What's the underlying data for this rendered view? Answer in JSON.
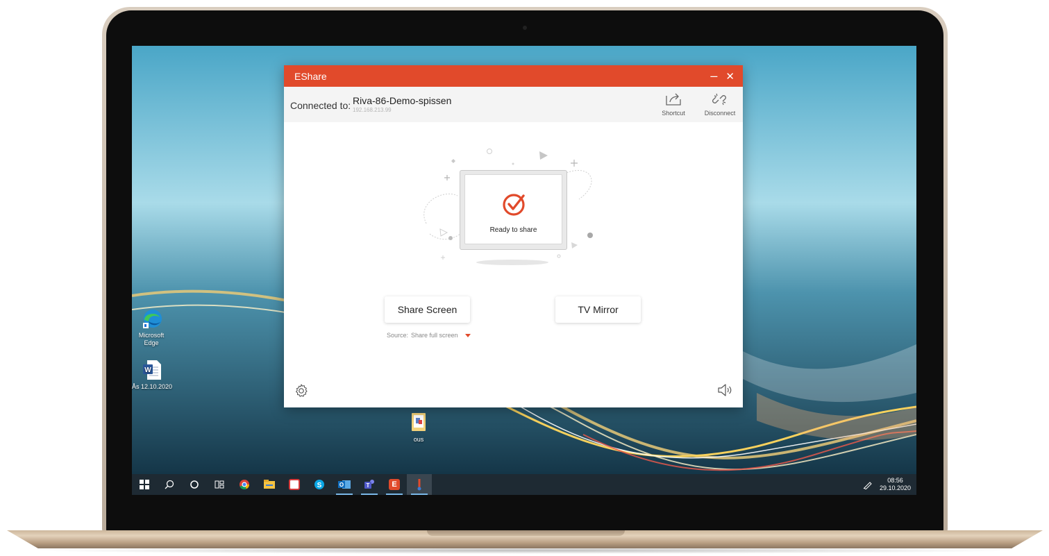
{
  "window": {
    "title": "EShare",
    "minimize_glyph": "–",
    "close_glyph": "✕",
    "accent_color": "#e14a2b"
  },
  "connection": {
    "label": "Connected to:",
    "device_name": "Riva-86-Demo-spissen",
    "ip": "192.168.213.99"
  },
  "toolbar": {
    "shortcut_label": "Shortcut",
    "disconnect_label": "Disconnect",
    "shortcut_icon": "share-arrow-icon",
    "disconnect_icon": "unlink-icon"
  },
  "status": {
    "text": "Ready to share",
    "icon": "check-circle-icon"
  },
  "actions": {
    "share_screen_label": "Share Screen",
    "tv_mirror_label": "TV Mirror"
  },
  "source": {
    "label": "Source:",
    "value": "Share full screen"
  },
  "footer": {
    "settings_icon": "gear-icon",
    "volume_icon": "speaker-icon"
  },
  "desktop": {
    "icons": [
      {
        "label_line1": "Microsoft",
        "label_line2": "Edge",
        "icon": "edge-icon"
      },
      {
        "label_line1": "Ås 12.10.2020",
        "label_line2": "",
        "icon": "word-document-icon"
      },
      {
        "label_line1": "ous",
        "label_line2": "",
        "icon": "folder-icon"
      }
    ]
  },
  "taskbar": {
    "items": [
      "windows-start-icon",
      "search-icon",
      "cortana-icon",
      "task-view-icon",
      "chrome-icon",
      "file-explorer-icon",
      "app-red-icon",
      "skype-icon",
      "outlook-icon",
      "teams-icon",
      "eshare-icon",
      "pinned-app-icon"
    ],
    "time": "08:56",
    "date": "29.10.2020"
  }
}
